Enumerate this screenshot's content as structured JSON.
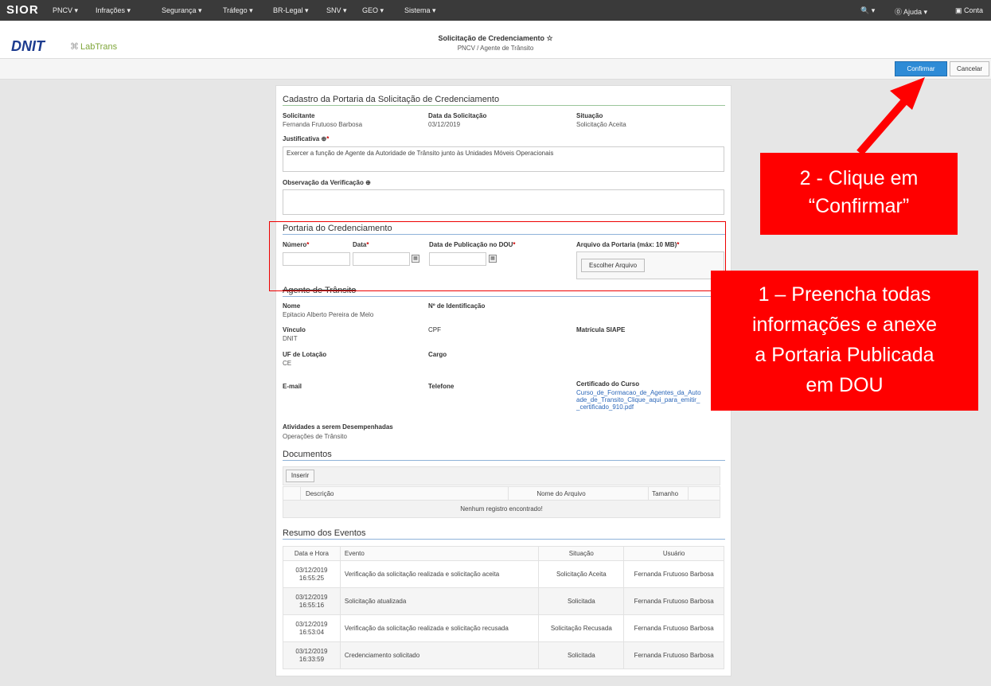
{
  "topnav": {
    "logo": "SIOR",
    "items": [
      "PNCV ▾",
      "Infrações ▾",
      "Segurança ▾",
      "Tráfego ▾",
      "BR-Legal ▾",
      "SNV ▾",
      "GEO ▾",
      "Sistema ▾"
    ],
    "search": "🔍 ▾",
    "help": "⓪ Ajuda ▾",
    "account": "▣ Conta"
  },
  "header": {
    "dnit": "DNIT",
    "labtrans": "LabTrans",
    "title": "Solicitação de Credenciamento ☆",
    "subtitle": "PNCV / Agente de Trânsito"
  },
  "toolbar": {
    "confirm": "Confirmar",
    "cancel": "Cancelar"
  },
  "cadastro": {
    "title": "Cadastro da Portaria da Solicitação de Credenciamento",
    "solicitante_label": "Solicitante",
    "solicitante": "Fernanda Frutuoso Barbosa",
    "data_label": "Data da Solicitação",
    "data": "03/12/2019",
    "situacao_label": "Situação",
    "situacao": "Solicitação Aceita",
    "justificativa_label": "Justificativa",
    "justificativa": "Exercer a função de Agente da Autoridade de Trânsito junto às Unidades Móveis Operacionais",
    "observacao_label": "Observação da Verificação"
  },
  "portaria": {
    "title": "Portaria do Credenciamento",
    "numero": "Número",
    "data": "Data",
    "data_pub": "Data de Publicação no DOU",
    "arquivo": "Arquivo da Portaria (máx: 10 MB)",
    "escolher": "Escolher Arquivo"
  },
  "agente": {
    "title": "Agente de Trânsito",
    "nome_label": "Nome",
    "nome": "Epitacio Alberto Pereira de Melo",
    "id_label": "Nº de Identificação",
    "vinculo_label": "Vínculo",
    "vinculo": "DNIT",
    "cpf_label": "CPF",
    "matricula_label": "Matrícula SIAPE",
    "uf_label": "UF de Lotação",
    "uf": "CE",
    "cargo_label": "Cargo",
    "email_label": "E-mail",
    "telefone_label": "Telefone",
    "cert_label": "Certificado do Curso",
    "cert_lines": [
      "Curso_de_Formacao_de_Agentes_da_Auto",
      "ade_de_Transito_Clique_aqui_para_emitir_",
      "_certificado_910.pdf"
    ],
    "atividades_label": "Atividades a serem Desempenhadas",
    "atividades": "Operações de Trânsito"
  },
  "documentos": {
    "title": "Documentos",
    "inserir": "Inserir",
    "headers": [
      "Descrição",
      "Nome do Arquivo",
      "Tamanho"
    ],
    "empty": "Nenhum registro encontrado!"
  },
  "eventos": {
    "title": "Resumo dos Eventos",
    "headers": [
      "Data e Hora",
      "Evento",
      "Situação",
      "Usuário"
    ],
    "rows": [
      {
        "date": "03/12/2019",
        "time": "16:55:25",
        "evento": "Verificação da solicitação realizada e solicitação aceita",
        "situacao": "Solicitação Aceita",
        "usuario": "Fernanda Frutuoso Barbosa"
      },
      {
        "date": "03/12/2019",
        "time": "16:55:16",
        "evento": "Solicitação atualizada",
        "situacao": "Solicitada",
        "usuario": "Fernanda Frutuoso Barbosa"
      },
      {
        "date": "03/12/2019",
        "time": "16:53:04",
        "evento": "Verificação da solicitação realizada e solicitação recusada",
        "situacao": "Solicitação Recusada",
        "usuario": "Fernanda Frutuoso Barbosa"
      },
      {
        "date": "03/12/2019",
        "time": "16:33:59",
        "evento": "Credenciamento solicitado",
        "situacao": "Solicitada",
        "usuario": "Fernanda Frutuoso Barbosa"
      }
    ]
  },
  "callouts": {
    "c2": [
      "2 - Clique em",
      "“Confirmar”"
    ],
    "c1": [
      "1 – Preencha todas",
      "informações e anexe",
      "a Portaria Publicada",
      "em DOU"
    ]
  },
  "colors": {
    "accent": "#2e8bd6",
    "callout": "#ff0000",
    "section_green": "#9bc59a",
    "section_blue": "#8fb3d9"
  }
}
